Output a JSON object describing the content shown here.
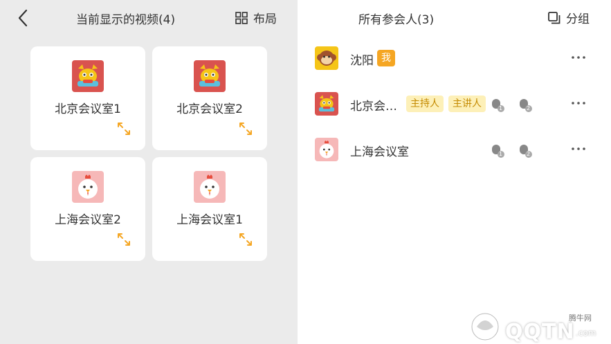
{
  "left_panel": {
    "title": "当前显示的视频(4)",
    "layout_label": "布局",
    "tiles": [
      {
        "name": "北京会议室1",
        "avatar": "dragon-avatar"
      },
      {
        "name": "北京会议室2",
        "avatar": "dragon-avatar"
      },
      {
        "name": "上海会议室2",
        "avatar": "rooster-avatar"
      },
      {
        "name": "上海会议室1",
        "avatar": "rooster-avatar"
      }
    ]
  },
  "right_panel": {
    "title": "所有参会人(3)",
    "group_label": "分组",
    "participants": [
      {
        "name": "沈阳",
        "avatar": "monkey-avatar",
        "me_badge": "我"
      },
      {
        "name": "北京会…",
        "avatar": "dragon-avatar",
        "roles": [
          "主持人",
          "主讲人"
        ],
        "mic1": "1",
        "mic2": "2"
      },
      {
        "name": "上海会议室",
        "avatar": "rooster-avatar",
        "mic1": "1",
        "mic2": "2"
      }
    ]
  },
  "watermark": {
    "small": "腾牛网",
    "big": "QQTN",
    "suffix": ".com"
  },
  "colors": {
    "accent": "#f5a623",
    "role_bg": "#fdf0b8",
    "role_text": "#c48a00",
    "panel_bg": "#ebebeb"
  }
}
